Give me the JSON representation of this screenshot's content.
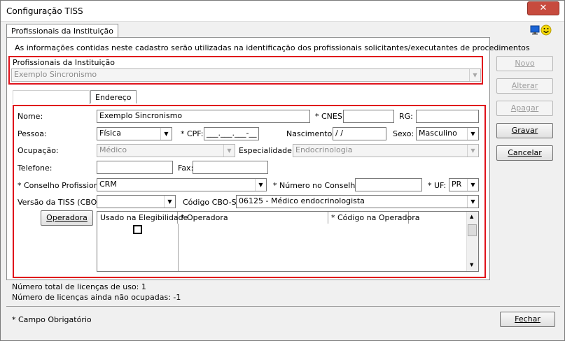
{
  "window": {
    "title": "Configuração TISS",
    "close_symbol": "✕"
  },
  "tabs": {
    "main_tab": "Profissionais da Instituição",
    "address_tab": "Endereço"
  },
  "info_text": "As informações contidas neste cadastro serão utilizadas na identificação dos profissionais solicitantes/executantes de procedimentos",
  "professional_selector": {
    "label": "Profissionais da Instituição",
    "value": "Exemplo Sincronismo"
  },
  "form": {
    "nome_label": "Nome:",
    "nome_value": "Exemplo Sincronismo",
    "cnes_label": "* CNES:",
    "cnes_value": "",
    "rg_label": "RG:",
    "rg_value": "",
    "pessoa_label": "Pessoa:",
    "pessoa_value": "Física",
    "cpf_label": "* CPF:",
    "cpf_value": "___.___.___-__",
    "nascimento_label": "Nascimento:",
    "nascimento_value": "/ /",
    "sexo_label": "Sexo:",
    "sexo_value": "Masculino",
    "ocupacao_label": "Ocupação:",
    "ocupacao_value": "Médico",
    "especialidade_label": "Especialidade:",
    "especialidade_value": "Endocrinologia",
    "telefone_label": "Telefone:",
    "telefone_value": "",
    "fax_label": "Fax:",
    "fax_value": "",
    "conselho_label": "* Conselho Profissional:",
    "conselho_value": "CRM",
    "numero_conselho_label": "* Número no Conselho:",
    "numero_conselho_value": "",
    "uf_label": "* UF:",
    "uf_value": "PR",
    "versao_tiss_label": "Versão da TISS (CBO):",
    "versao_tiss_value": "",
    "cbo_label": "Código CBO-S:",
    "cbo_value": "06125 - Médico endocrinologista"
  },
  "operadora": {
    "button_label": "Operadora",
    "columns": [
      "Usado na Elegibilidade",
      "* Operadora",
      "* Código na Operadora"
    ],
    "rows": [
      {
        "usado": false,
        "operadora": "",
        "codigo": ""
      }
    ]
  },
  "buttons": {
    "novo": "Novo",
    "alterar": "Alterar",
    "apagar": "Apagar",
    "gravar": "Gravar",
    "cancelar": "Cancelar",
    "fechar": "Fechar"
  },
  "licenses": {
    "total": "Número total de licenças de uso: 1",
    "available": "Número de licenças ainda não ocupadas: -1"
  },
  "footer_note": "* Campo Obrigatório",
  "colors": {
    "highlight": "#e0121b",
    "monitor_icon": "#1a64d6",
    "smiley_icon": "#f5d90a"
  }
}
